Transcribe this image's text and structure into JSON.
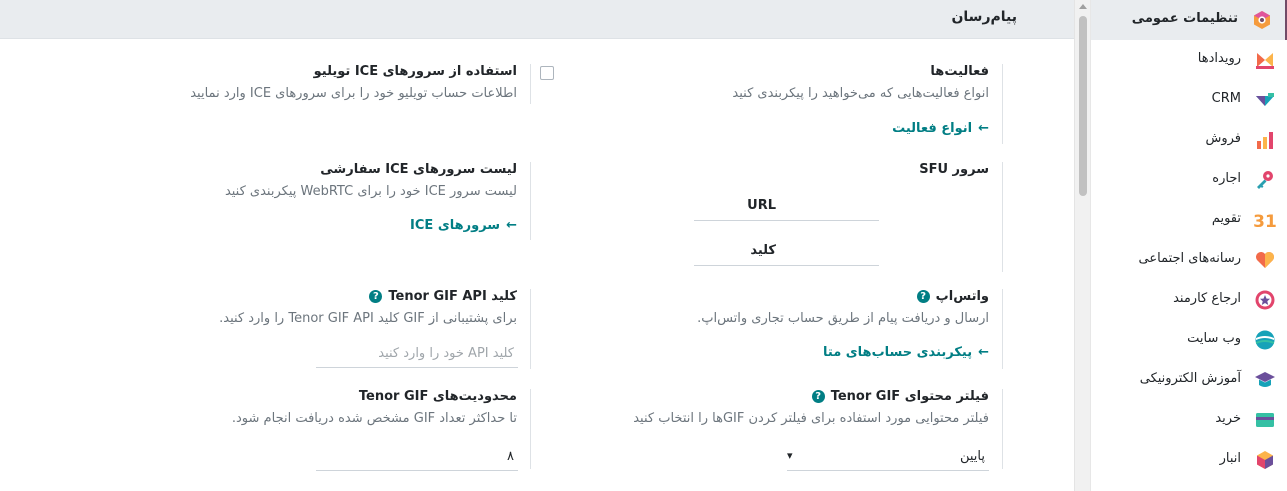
{
  "section": {
    "title": "پیام‌رسان"
  },
  "settings": {
    "activities": {
      "title": "فعالیت‌ها",
      "desc": "انواع فعالیت‌هایی که می‌خواهید را پیکربندی کنید",
      "link": "انواع فعالیت",
      "link_arrow": "←"
    },
    "twilio": {
      "title": "استفاده از سرورهای ICE تویلیو",
      "desc": "اطلاعات حساب تویلیو خود را برای سرورهای ICE وارد نمایید",
      "checked": false
    },
    "sfu": {
      "title": "سرور SFU",
      "url_label": "URL",
      "url_value": "",
      "key_label": "کلید",
      "key_value": ""
    },
    "ice_list": {
      "title": "لیست سرورهای ICE سفارشی",
      "desc": "لیست سرور ICE خود را برای WebRTC پیکربندی کنید",
      "link": "سرورهای ICE",
      "link_arrow": "←"
    },
    "whatsapp": {
      "title": "واتس‌اپ",
      "help": "?",
      "desc": "ارسال و دریافت پیام از طریق حساب تجاری واتس‌اپ.",
      "link": "پیکربندی حساب‌های متا",
      "link_arrow": "←"
    },
    "tenor_key": {
      "title": "کلید Tenor GIF API",
      "help": "?",
      "desc": "برای پشتیبانی از GIF کلید Tenor GIF API را وارد کنید.",
      "placeholder": "کلید API خود را وارد کنید",
      "value": ""
    },
    "tenor_filter": {
      "title": "فیلتر محتوای Tenor GIF",
      "help": "?",
      "desc": "فیلتر محتوایی مورد استفاده برای فیلتر کردن GIFها را انتخاب کنید",
      "selected": "پایین",
      "caret": "▾"
    },
    "tenor_limit": {
      "title": "محدودیت‌های Tenor GIF",
      "desc": "تا حداکثر تعداد GIF مشخص شده دریافت انجام شود.",
      "value": "۸"
    }
  },
  "sidebar": {
    "items": [
      {
        "label": "تنظیمات عمومی",
        "icon": "settings-icon",
        "active": true
      },
      {
        "label": "رویدادها",
        "icon": "events-icon"
      },
      {
        "label": "CRM",
        "icon": "crm-icon"
      },
      {
        "label": "فروش",
        "icon": "sales-icon"
      },
      {
        "label": "اجاره",
        "icon": "rental-icon"
      },
      {
        "label": "تقویم",
        "icon": "calendar-icon"
      },
      {
        "label": "رسانه‌های اجتماعی",
        "icon": "social-icon"
      },
      {
        "label": "ارجاع کارمند",
        "icon": "referral-icon"
      },
      {
        "label": "وب سایت",
        "icon": "website-icon"
      },
      {
        "label": "آموزش الکترونیکی",
        "icon": "elearning-icon"
      },
      {
        "label": "خرید",
        "icon": "purchase-icon"
      },
      {
        "label": "انبار",
        "icon": "inventory-icon"
      }
    ],
    "calendar_icon_text": "31"
  }
}
